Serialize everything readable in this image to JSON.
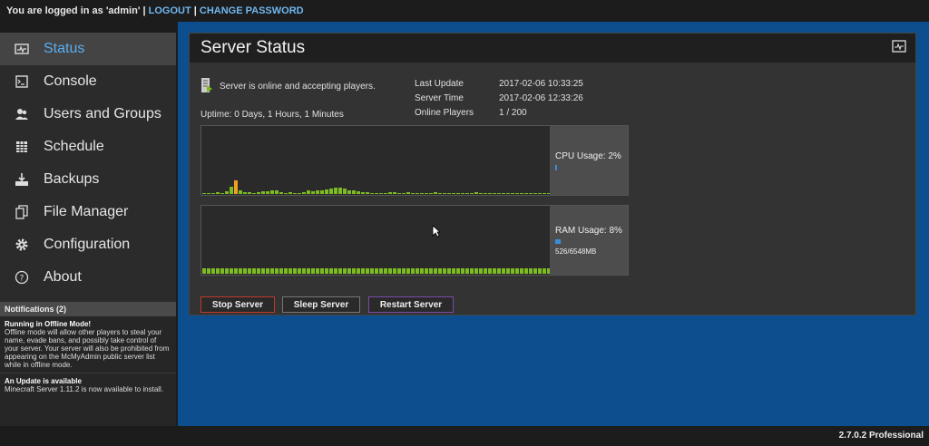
{
  "topbar": {
    "logged_in_text": "You are logged in as 'admin' |",
    "logout_label": "LOGOUT",
    "separator": "|",
    "change_password_label": "CHANGE PASSWORD"
  },
  "sidebar": {
    "items": [
      {
        "label": "Status",
        "icon": "status-icon",
        "active": true
      },
      {
        "label": "Console",
        "icon": "console-icon"
      },
      {
        "label": "Users and Groups",
        "icon": "users-icon"
      },
      {
        "label": "Schedule",
        "icon": "schedule-icon"
      },
      {
        "label": "Backups",
        "icon": "backup-icon"
      },
      {
        "label": "File Manager",
        "icon": "files-icon"
      },
      {
        "label": "Configuration",
        "icon": "gear-icon"
      },
      {
        "label": "About",
        "icon": "help-icon"
      }
    ]
  },
  "notifications": {
    "header": "Notifications (2)",
    "items": [
      {
        "title": "Running in Offline Mode!",
        "text": "Offline mode will allow other players to steal your name, evade bans, and possibly take control of your server. Your server will also be prohibited from appearing on the McMyAdmin public server list while in offline mode."
      },
      {
        "title": "An Update is available",
        "text": "Minecraft Server 1.11.2 is now available to install."
      }
    ]
  },
  "panel": {
    "title": "Server Status",
    "status_text": "Server is online and accepting players.",
    "uptime": "Uptime: 0 Days, 1 Hours, 1 Minutes",
    "info": {
      "last_update_label": "Last Update",
      "last_update": "2017-02-06 10:33:25",
      "server_time_label": "Server Time",
      "server_time": "2017-02-06 12:33:26",
      "online_players_label": "Online Players",
      "online_players": "1 / 200"
    },
    "cpu": {
      "label": "CPU Usage: 2%",
      "percent": 2
    },
    "ram": {
      "label": "RAM Usage: 8%",
      "percent": 8,
      "detail": "526/6548MB"
    },
    "buttons": {
      "stop": "Stop Server",
      "sleep": "Sleep Server",
      "restart": "Restart Server"
    }
  },
  "colors": {
    "accent": "#5aaef0",
    "background_main": "#0d4e8e",
    "bar_green": "#7cbb22",
    "bar_orange": "#f0a020",
    "stop_border": "#c0392b",
    "restart_border": "#7a4aa8"
  },
  "cpu_history": [
    2,
    2,
    2,
    3,
    2,
    4,
    11,
    20,
    6,
    3,
    3,
    2,
    3,
    4,
    4,
    5,
    6,
    3,
    2,
    3,
    2,
    2,
    3,
    5,
    4,
    5,
    6,
    7,
    8,
    9,
    10,
    8,
    6,
    5,
    4,
    3,
    3,
    2,
    2,
    2,
    2,
    3,
    3,
    2,
    2,
    3,
    2,
    2,
    2,
    2,
    2,
    3,
    2,
    2,
    2,
    2,
    2,
    2,
    2,
    2,
    3,
    2,
    2,
    2,
    1,
    1,
    1,
    1,
    2,
    2,
    2,
    2,
    2,
    2,
    1,
    1,
    1
  ],
  "ram_history": [
    8,
    8,
    8,
    8,
    8,
    8,
    8,
    8,
    8,
    8,
    8,
    8,
    8,
    8,
    8,
    8,
    8,
    8,
    8,
    8,
    8,
    8,
    8,
    8,
    8,
    8,
    8,
    8,
    8,
    8,
    8,
    8,
    8,
    8,
    8,
    8,
    8,
    8,
    8,
    8,
    8,
    8,
    8,
    8,
    8,
    8,
    8,
    8,
    8,
    8,
    8,
    8,
    8,
    8,
    8,
    8,
    8,
    8,
    8,
    8,
    8,
    8,
    8,
    8,
    8,
    8,
    8,
    8,
    8,
    8,
    8,
    8,
    8,
    8,
    8,
    8,
    8
  ],
  "footer": {
    "version": "2.7.0.2 Professional"
  }
}
